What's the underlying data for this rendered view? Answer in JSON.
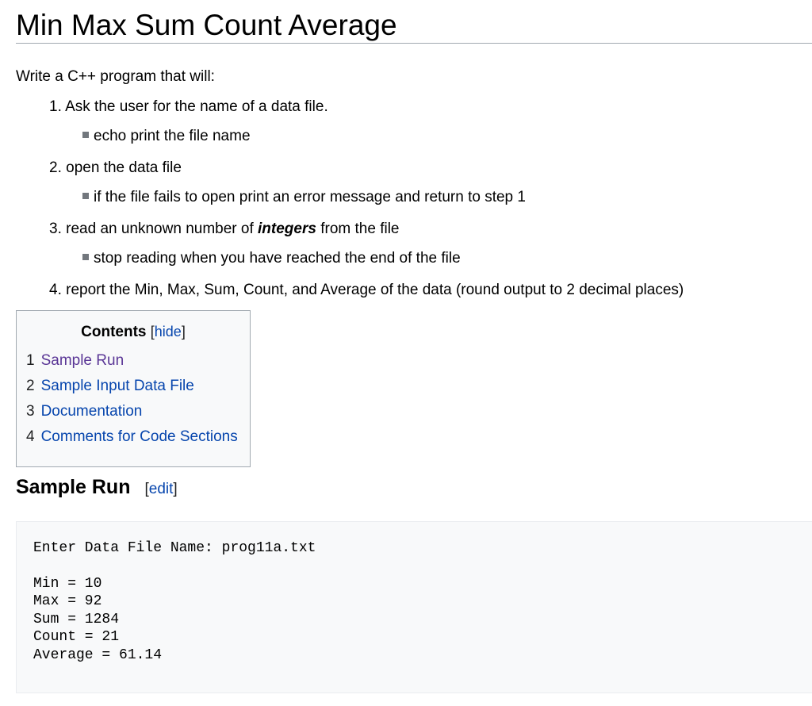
{
  "page": {
    "title": "Min Max Sum Count Average",
    "intro": "Write a C++ program that will:"
  },
  "steps": [
    {
      "number": "1.",
      "text": "Ask the user for the name of a data file.",
      "sub": "echo print the file name"
    },
    {
      "number": "2.",
      "text": "open the data file",
      "sub": "if the file fails to open print an error message and return to step 1"
    },
    {
      "number": "3.",
      "text_before": "read an unknown number of ",
      "text_emphasis": "integers",
      "text_after": " from the file",
      "sub": "stop reading when you have reached the end of the file"
    },
    {
      "number": "4.",
      "text": "report the Min, Max, Sum, Count, and Average of the data (round output to 2 decimal places)"
    }
  ],
  "toc": {
    "title": "Contents",
    "hide_open": "[",
    "hide_label": "hide",
    "hide_close": "]",
    "items": [
      {
        "num": "1",
        "label": "Sample Run"
      },
      {
        "num": "2",
        "label": "Sample Input Data File"
      },
      {
        "num": "3",
        "label": "Documentation"
      },
      {
        "num": "4",
        "label": "Comments for Code Sections"
      }
    ]
  },
  "section": {
    "title": "Sample Run",
    "edit_open": "[",
    "edit_label": "edit",
    "edit_close": "]"
  },
  "sample_run": {
    "prompt": "Enter Data File Name: prog11a.txt",
    "lines": [
      "Min = 10",
      "Max = 92",
      "Sum = 1284",
      "Count = 21",
      "Average = 61.14"
    ]
  },
  "colors": {
    "link": "#0645ad",
    "visited_link": "#5a3696",
    "toc_background": "#f8f9fa",
    "border": "#a2a9b1"
  }
}
